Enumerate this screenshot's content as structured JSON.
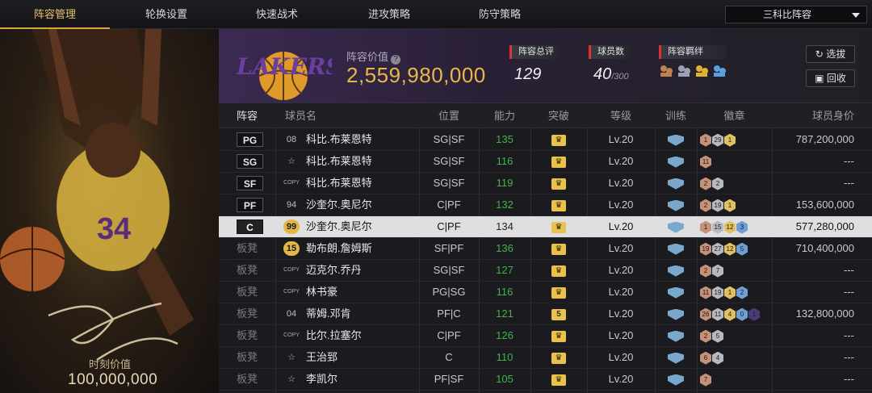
{
  "tabs": [
    "阵容管理",
    "轮换设置",
    "快速战术",
    "进攻策略",
    "防守策略"
  ],
  "dropdown": {
    "value": "三科比阵容"
  },
  "left": {
    "moment_label": "时刻价值",
    "moment_value": "100,000,000"
  },
  "header": {
    "logo": "LAKERS",
    "value_label": "阵容价值",
    "value": "2,559,980,000",
    "stats": [
      {
        "label": "阵容总评",
        "value": "129",
        "sub": ""
      },
      {
        "label": "球员数",
        "value": "40",
        "sub": "/300"
      },
      {
        "label": "阵容羁绊",
        "value": "",
        "sub": ""
      }
    ],
    "buttons": [
      "选拔",
      "回收"
    ]
  },
  "table": {
    "columns": [
      "阵容",
      "球员名",
      "位置",
      "能力",
      "突破",
      "等级",
      "训练",
      "徽章",
      "球员身价"
    ],
    "rows": [
      {
        "slot": "PG",
        "num": "08",
        "name": "科比.布莱恩特",
        "pos": "SG|SF",
        "ability": "135",
        "breakthrough": "",
        "level": "Lv.20",
        "badges": [
          "1",
          "29",
          "1"
        ],
        "price": "787,200,000"
      },
      {
        "slot": "SG",
        "num": "☆",
        "name": "科比.布莱恩特",
        "pos": "SG|SF",
        "ability": "116",
        "breakthrough": "",
        "level": "Lv.20",
        "badges": [
          "11"
        ],
        "price": "---"
      },
      {
        "slot": "SF",
        "num": "COPY",
        "name": "科比.布莱恩特",
        "pos": "SG|SF",
        "ability": "119",
        "breakthrough": "",
        "level": "Lv.20",
        "badges": [
          "2",
          "2"
        ],
        "price": "---"
      },
      {
        "slot": "PF",
        "num": "94",
        "name": "沙奎尔.奥尼尔",
        "pos": "C|PF",
        "ability": "132",
        "breakthrough": "",
        "level": "Lv.20",
        "badges": [
          "2",
          "19",
          "1"
        ],
        "price": "153,600,000"
      },
      {
        "slot": "C",
        "num": "99",
        "name": "沙奎尔.奥尼尔",
        "pos": "C|PF",
        "ability": "134",
        "breakthrough": "",
        "level": "Lv.20",
        "badges": [
          "1",
          "15",
          "12",
          "3"
        ],
        "price": "577,280,000"
      },
      {
        "slot": "板凳",
        "num": "15",
        "name": "勒布朗.詹姆斯",
        "pos": "SF|PF",
        "ability": "136",
        "breakthrough": "",
        "level": "Lv.20",
        "badges": [
          "19",
          "27",
          "12",
          "5"
        ],
        "price": "710,400,000"
      },
      {
        "slot": "板凳",
        "num": "COPY",
        "name": "迈克尔.乔丹",
        "pos": "SG|SF",
        "ability": "127",
        "breakthrough": "",
        "level": "Lv.20",
        "badges": [
          "2",
          "7"
        ],
        "price": "---"
      },
      {
        "slot": "板凳",
        "num": "COPY",
        "name": "林书豪",
        "pos": "PG|SG",
        "ability": "116",
        "breakthrough": "",
        "level": "Lv.20",
        "badges": [
          "11",
          "19",
          "1",
          "2"
        ],
        "price": "---"
      },
      {
        "slot": "板凳",
        "num": "04",
        "name": "蒂姆.邓肯",
        "pos": "PF|C",
        "ability": "121",
        "breakthrough": "5",
        "level": "Lv.20",
        "badges": [
          "26",
          "11",
          "4",
          "0",
          "1"
        ],
        "price": "132,800,000"
      },
      {
        "slot": "板凳",
        "num": "COPY",
        "name": "比尔.拉塞尔",
        "pos": "C|PF",
        "ability": "126",
        "breakthrough": "",
        "level": "Lv.20",
        "badges": [
          "2",
          "5"
        ],
        "price": "---"
      },
      {
        "slot": "板凳",
        "num": "☆",
        "name": "王治郅",
        "pos": "C",
        "ability": "110",
        "breakthrough": "",
        "level": "Lv.20",
        "badges": [
          "6",
          "4"
        ],
        "price": "---"
      },
      {
        "slot": "板凳",
        "num": "☆",
        "name": "李凯尔",
        "pos": "PF|SF",
        "ability": "105",
        "breakthrough": "",
        "level": "Lv.20",
        "badges": [
          "7"
        ],
        "price": "---"
      }
    ]
  }
}
